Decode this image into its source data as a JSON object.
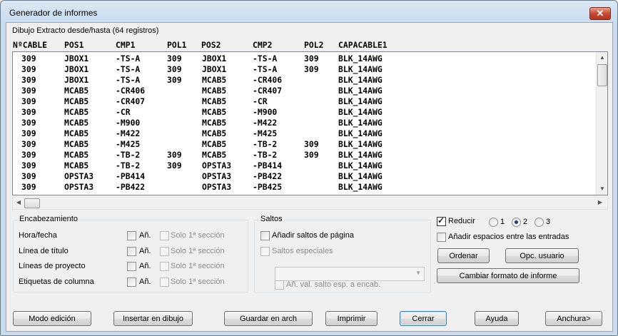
{
  "window": {
    "title": "Generador de informes",
    "close_glyph": "✕"
  },
  "report": {
    "caption": "Dibujo Extracto desde/hasta (64 registros)",
    "columns": [
      "NºCABLE",
      "POS1",
      "CMP1",
      "POL1",
      "POS2",
      "CMP2",
      "POL2",
      "CAPACABLE1"
    ],
    "rows": [
      [
        "309",
        "JBOX1",
        "-TS-A",
        "309",
        "JBOX1",
        "-TS-A",
        "309",
        "BLK_14AWG"
      ],
      [
        "309",
        "JBOX1",
        "-TS-A",
        "309",
        "JBOX1",
        "-TS-A",
        "309",
        "BLK_14AWG"
      ],
      [
        "309",
        "JBOX1",
        "-TS-A",
        "309",
        "MCAB5",
        "-CR406",
        "",
        "BLK_14AWG"
      ],
      [
        "309",
        "MCAB5",
        "-CR406",
        "",
        "MCAB5",
        "-CR407",
        "",
        "BLK_14AWG"
      ],
      [
        "309",
        "MCAB5",
        "-CR407",
        "",
        "MCAB5",
        "-CR",
        "",
        "BLK_14AWG"
      ],
      [
        "309",
        "MCAB5",
        "-CR",
        "",
        "MCAB5",
        "-M900",
        "",
        "BLK_14AWG"
      ],
      [
        "309",
        "MCAB5",
        "-M900",
        "",
        "MCAB5",
        "-M422",
        "",
        "BLK_14AWG"
      ],
      [
        "309",
        "MCAB5",
        "-M422",
        "",
        "MCAB5",
        "-M425",
        "",
        "BLK_14AWG"
      ],
      [
        "309",
        "MCAB5",
        "-M425",
        "",
        "MCAB5",
        "-TB-2",
        "309",
        "BLK_14AWG"
      ],
      [
        "309",
        "MCAB5",
        "-TB-2",
        "309",
        "MCAB5",
        "-TB-2",
        "309",
        "BLK_14AWG"
      ],
      [
        "309",
        "MCAB5",
        "-TB-2",
        "309",
        "OPSTA3",
        "-PB414",
        "",
        "BLK_14AWG"
      ],
      [
        "309",
        "OPSTA3",
        "-PB414",
        "",
        "OPSTA3",
        "-PB422",
        "",
        "BLK_14AWG"
      ],
      [
        "309",
        "OPSTA3",
        "-PB422",
        "",
        "OPSTA3",
        "-PB425",
        "",
        "BLK_14AWG"
      ]
    ]
  },
  "encabezamiento": {
    "title": "Encabezamiento",
    "add_label": "Añ.",
    "section_label": "Solo 1ª sección",
    "rows": [
      {
        "label": "Hora/fecha"
      },
      {
        "label": "Línea de título"
      },
      {
        "label": "Líneas de proyecto"
      },
      {
        "label": "Etiquetas de columna"
      }
    ]
  },
  "saltos": {
    "title": "Saltos",
    "add_page_breaks": "Añadir saltos de página",
    "special_breaks": "Saltos especiales",
    "combo_value": "",
    "add_value_label": "Añ. val. salto esp. a encab."
  },
  "options": {
    "reducir_label": "Reducir",
    "reducir_checked": true,
    "radio_labels": [
      "1",
      "2",
      "3"
    ],
    "radio_selected": "2",
    "spaces_label": "Añadir espacios entre las entradas",
    "ordenar": "Ordenar",
    "opc_usuario": "Opc. usuario",
    "cambiar_formato": "Cambiar formato de informe"
  },
  "bottom_buttons": {
    "modo_edicion": "Modo edición",
    "insertar": "Insertar en dibujo",
    "guardar": "Guardar en arch",
    "imprimir": "Imprimir",
    "cerrar": "Cerrar",
    "ayuda": "Ayuda",
    "anchura": "Anchura>"
  }
}
